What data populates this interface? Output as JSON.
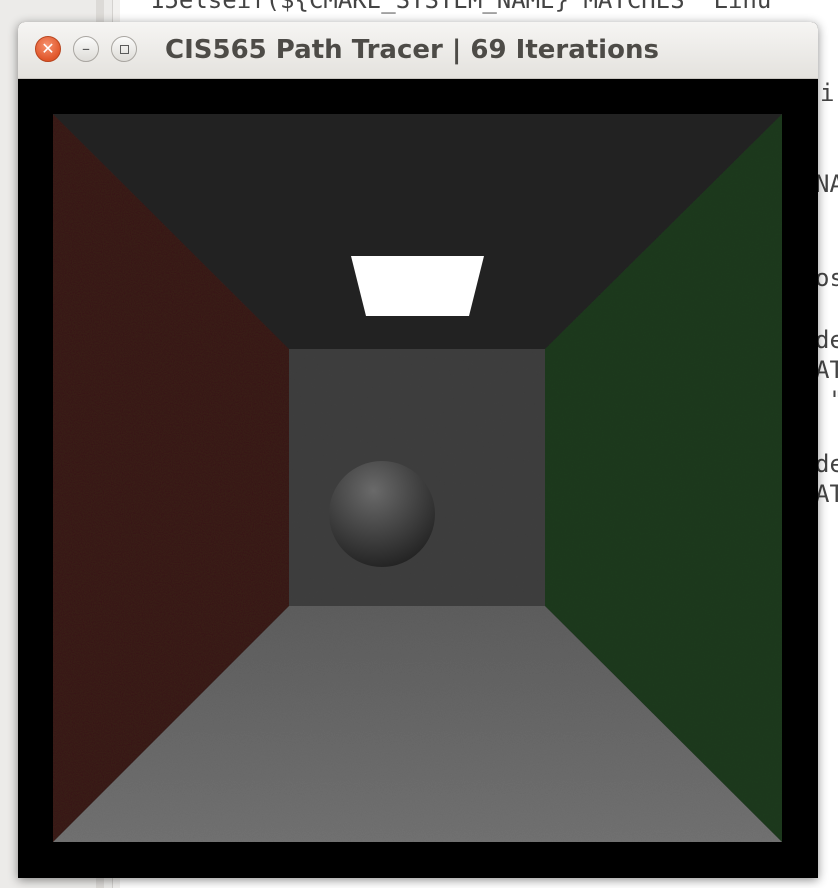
{
  "window": {
    "title": "CIS565 Path Tracer | 69 Iterations",
    "buttons": {
      "close_icon": "close-icon",
      "minimize_icon": "minimize-icon",
      "maximize_icon": "maximize-icon"
    }
  },
  "editor_fragments": [
    {
      "text": "15elseif(${CMAKE_SYSTEM_NAME} MATCHES \"Linu",
      "cls": "code-line"
    },
    {
      "text": "i",
      "cls": "code-line"
    },
    {
      "text": "NA",
      "cls": "code-line"
    },
    {
      "text": "os",
      "cls": "code-line"
    },
    {
      "text": "de",
      "cls": "code-line"
    },
    {
      "text": "AT",
      "cls": "code-line"
    },
    {
      "text": " \"",
      "cls": "code-line"
    },
    {
      "text": "de",
      "cls": "code-line"
    },
    {
      "text": "AT",
      "cls": "code-line"
    }
  ],
  "render": {
    "scene": "cornell-box",
    "colors": {
      "left_wall": "#3a1a18",
      "right_wall": "#1d3a1c",
      "ceiling": "#222222",
      "back_wall": "#3f3f3f",
      "floor": "#6e6e6e",
      "light": "#ffffff",
      "sphere_light": "#6a6a6a",
      "sphere_dark": "#222222"
    }
  }
}
